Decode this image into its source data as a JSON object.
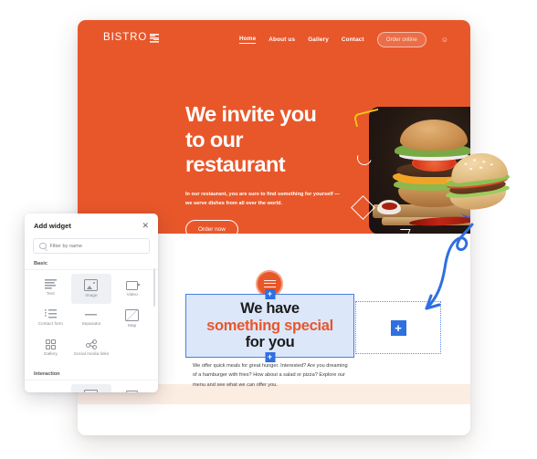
{
  "site": {
    "logo": {
      "text": "BISTRO",
      "mark": "emblem-icon"
    },
    "nav": [
      {
        "label": "Home",
        "active": true
      },
      {
        "label": "About us",
        "active": false
      },
      {
        "label": "Gallery",
        "active": false
      },
      {
        "label": "Contact",
        "active": false
      }
    ],
    "order_online_label": "Order online",
    "account_icon": "person-icon",
    "hero": {
      "title_line1": "We invite you",
      "title_line2": "to our",
      "title_line3": "restaurant",
      "subtitle": "In our restaurant, you are sure to find something for yourself — we serve dishes from all over the world.",
      "cta_label": "Order now",
      "photo_alt": "hamburger-photo"
    },
    "content": {
      "heading_line1": "We have",
      "heading_line2": "something special",
      "heading_line3": "for you",
      "paragraph": "We offer quick meals for great hunger. Interested? Are you dreaming of a hamburger with fries? How about a salad or pizza? Explore our menu and see what we can offer you.",
      "drop_zone_add_label": "+",
      "handle_label": "+"
    }
  },
  "add_widget_panel": {
    "title": "Add widget",
    "close_label": "✕",
    "search_placeholder": "Filter by name",
    "search_value": "",
    "sections": [
      {
        "label": "Basic",
        "widgets": [
          {
            "label": "Text",
            "icon": "text-icon",
            "selected": false
          },
          {
            "label": "Image",
            "icon": "image-icon",
            "selected": true
          },
          {
            "label": "Video",
            "icon": "video-icon",
            "selected": false
          },
          {
            "label": "Contact form",
            "icon": "contact-form-icon",
            "selected": false
          },
          {
            "label": "Separator",
            "icon": "separator-icon",
            "selected": false
          },
          {
            "label": "Map",
            "icon": "map-icon",
            "selected": false
          },
          {
            "label": "Gallery",
            "icon": "gallery-icon",
            "selected": false
          },
          {
            "label": "Social media links",
            "icon": "social-links-icon",
            "selected": false
          }
        ]
      },
      {
        "label": "Interaction",
        "widgets": [
          {
            "label": "",
            "icon": "separator-icon",
            "selected": false
          },
          {
            "label": "",
            "icon": "image-icon",
            "selected": true
          },
          {
            "label": "",
            "icon": "video-icon",
            "selected": false
          }
        ]
      }
    ]
  },
  "drag": {
    "burger_icon": "hamburger-icon",
    "arrow_icon": "curved-arrow-icon"
  },
  "colors": {
    "brand_orange": "#E8572A",
    "accent_blue": "#2F6FE0",
    "selection_fill": "#DCE7FA",
    "footer_strip": "#FCEDE2"
  }
}
